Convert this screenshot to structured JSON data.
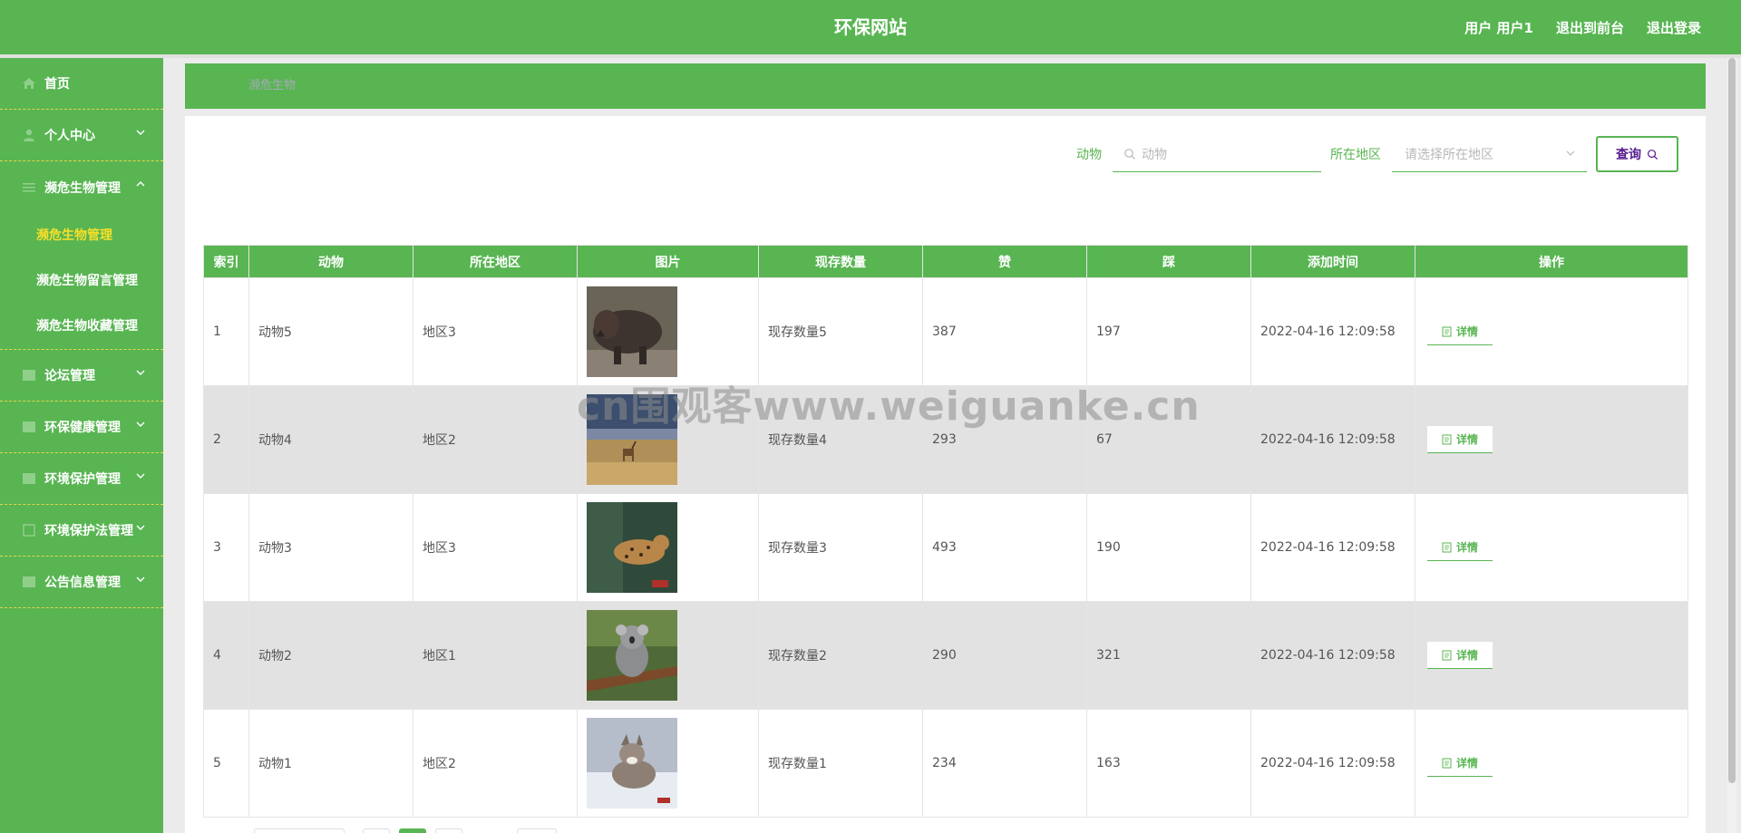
{
  "header": {
    "site_title": "环保网站",
    "user_label": "用户 用户1",
    "to_frontend": "退出到前台",
    "logout": "退出登录"
  },
  "sidebar": {
    "items": [
      {
        "label": "首页",
        "icon": "home-icon"
      },
      {
        "label": "个人中心",
        "icon": "user-icon"
      },
      {
        "label": "濒危生物管理",
        "icon": "list-icon",
        "expanded": true
      },
      {
        "label": "论坛管理",
        "icon": "grid-icon"
      },
      {
        "label": "环保健康管理",
        "icon": "grid-icon"
      },
      {
        "label": "环境保护管理",
        "icon": "grid-icon"
      },
      {
        "label": "环境保护法管理",
        "icon": "doc-icon"
      },
      {
        "label": "公告信息管理",
        "icon": "grid-icon"
      }
    ],
    "subitems": [
      {
        "label": "濒危生物管理",
        "active": true
      },
      {
        "label": "濒危生物留言管理"
      },
      {
        "label": "濒危生物收藏管理"
      }
    ]
  },
  "breadcrumb": "濒危生物",
  "search": {
    "animal_label": "动物",
    "animal_placeholder": "动物",
    "region_label": "所在地区",
    "region_placeholder": "请选择所在地区",
    "query_button": "查询"
  },
  "table": {
    "headers": [
      "索引",
      "动物",
      "所在地区",
      "图片",
      "现存数量",
      "赞",
      "踩",
      "添加时间",
      "操作"
    ],
    "detail_label": "详情",
    "rows": [
      {
        "index": "1",
        "animal": "动物5",
        "region": "地区3",
        "quantity": "现存数量5",
        "likes": "387",
        "dislikes": "197",
        "time": "2022-04-16 12:09:58",
        "image": "rhino"
      },
      {
        "index": "2",
        "animal": "动物4",
        "region": "地区2",
        "quantity": "现存数量4",
        "likes": "293",
        "dislikes": "67",
        "time": "2022-04-16 12:09:58",
        "image": "antelope-plain"
      },
      {
        "index": "3",
        "animal": "动物3",
        "region": "地区3",
        "quantity": "现存数量3",
        "likes": "493",
        "dislikes": "190",
        "time": "2022-04-16 12:09:58",
        "image": "leopard"
      },
      {
        "index": "4",
        "animal": "动物2",
        "region": "地区1",
        "quantity": "现存数量2",
        "likes": "290",
        "dislikes": "321",
        "time": "2022-04-16 12:09:58",
        "image": "koala"
      },
      {
        "index": "5",
        "animal": "动物1",
        "region": "地区2",
        "quantity": "现存数量1",
        "likes": "234",
        "dislikes": "163",
        "time": "2022-04-16 12:09:58",
        "image": "fox-snow"
      }
    ]
  },
  "watermark": "cn围观客www.weiguanke.cn",
  "colors": {
    "accent": "#58b552",
    "active_sub": "#f7df29",
    "divider": "#e6d54a",
    "alt_row": "#e2e2e2"
  }
}
